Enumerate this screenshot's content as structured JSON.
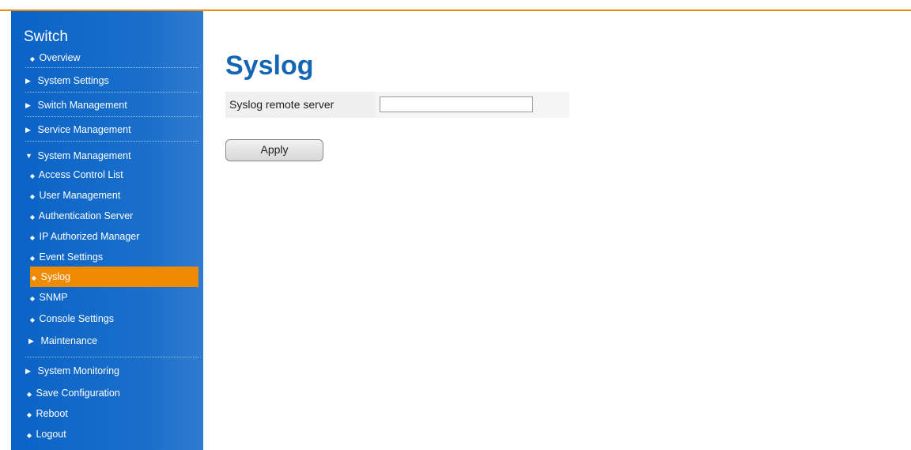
{
  "page": {
    "title": "Syslog"
  },
  "sidebar": {
    "title": "Switch",
    "items": [
      {
        "label": "Overview",
        "marker": "◆"
      },
      {
        "label": "System Settings",
        "marker": "▶"
      },
      {
        "label": "Switch Management",
        "marker": "▶"
      },
      {
        "label": "Service Management",
        "marker": "▶"
      },
      {
        "label": "System Management",
        "marker": "▼"
      },
      {
        "label": "Access Control List",
        "marker": "◆"
      },
      {
        "label": "User Management",
        "marker": "◆"
      },
      {
        "label": "Authentication Server",
        "marker": "◆"
      },
      {
        "label": "IP Authorized Manager",
        "marker": "◆"
      },
      {
        "label": "Event Settings",
        "marker": "◆"
      },
      {
        "label": "Syslog",
        "marker": "◆",
        "active": true
      },
      {
        "label": "SNMP",
        "marker": "◆"
      },
      {
        "label": "Console Settings",
        "marker": "◆"
      },
      {
        "label": "Maintenance",
        "marker": "▶"
      },
      {
        "label": "System Monitoring",
        "marker": "▶"
      },
      {
        "label": "Save Configuration",
        "marker": "◆"
      },
      {
        "label": "Reboot",
        "marker": "◆"
      },
      {
        "label": "Logout",
        "marker": "◆"
      }
    ]
  },
  "form": {
    "remote_server_label": "Syslog remote server",
    "remote_server_value": "",
    "apply_label": "Apply"
  },
  "colors": {
    "sidebar": "#0a63c6",
    "active": "#f08a00",
    "title": "#1565b5",
    "accent_line": "#e98a10"
  }
}
